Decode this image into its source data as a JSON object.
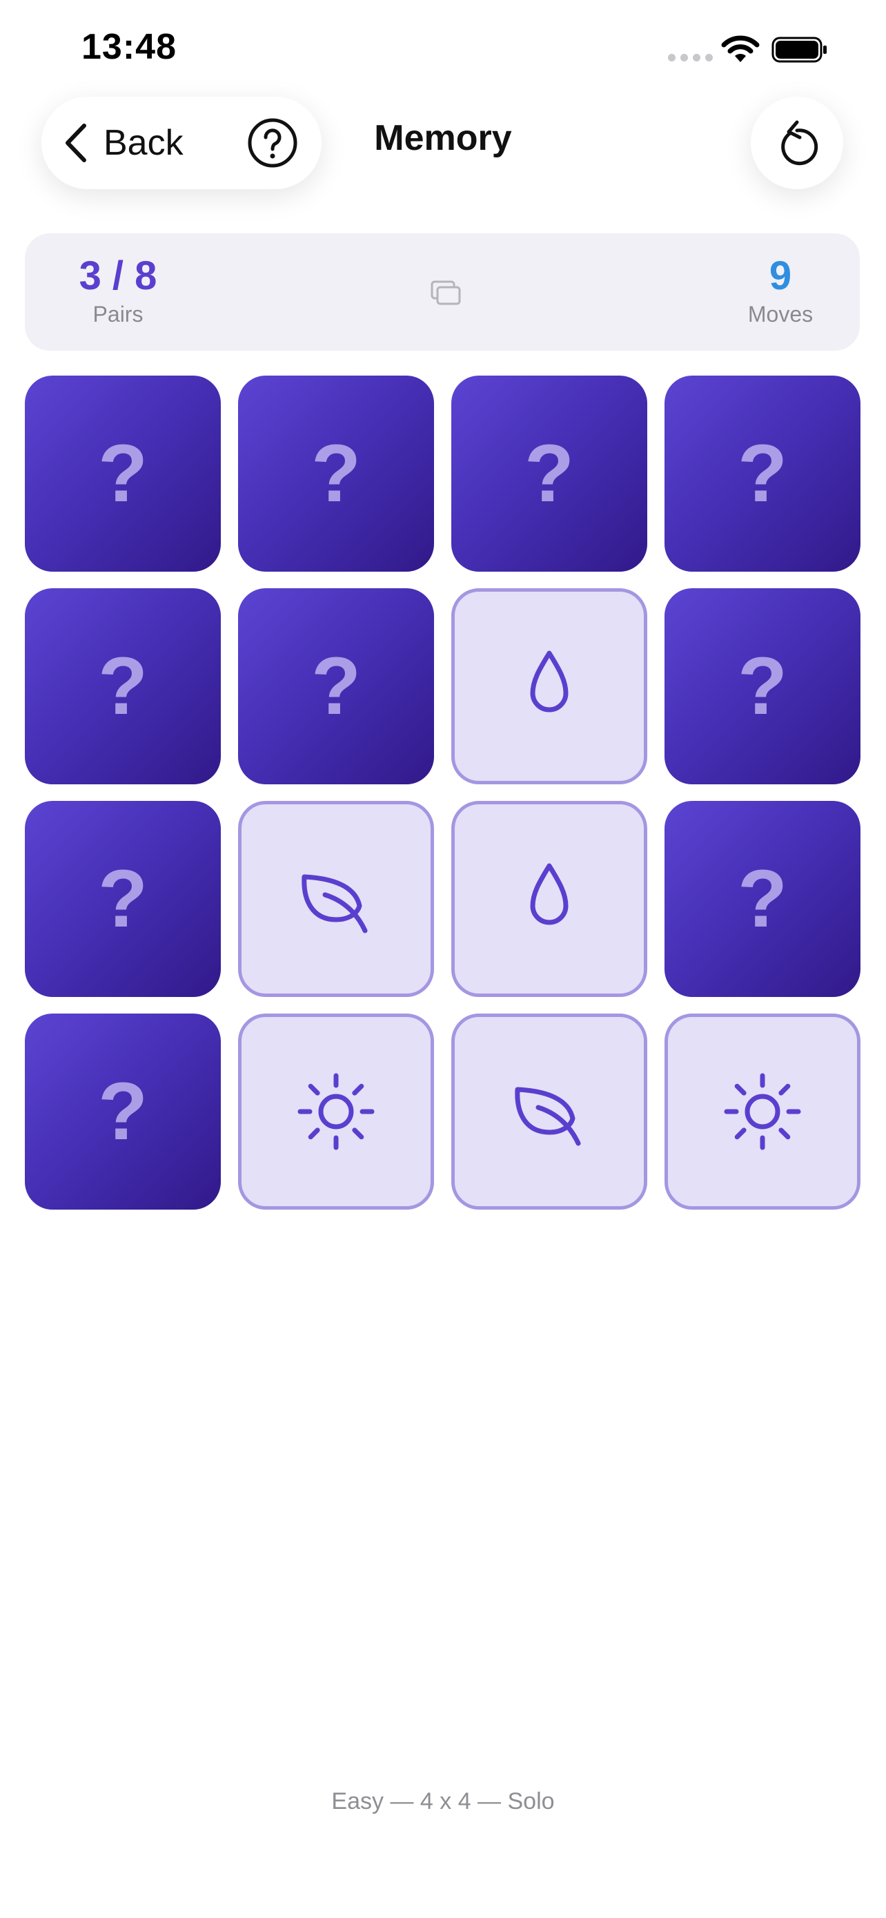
{
  "status_bar": {
    "time": "13:48"
  },
  "nav": {
    "back_label": "Back",
    "title": "Memory"
  },
  "score": {
    "pairs_value": "3 / 8",
    "pairs_label": "Pairs",
    "moves_value": "9",
    "moves_label": "Moves"
  },
  "board": {
    "hidden_glyph": "?",
    "cards": [
      {
        "state": "hidden"
      },
      {
        "state": "hidden"
      },
      {
        "state": "hidden"
      },
      {
        "state": "hidden"
      },
      {
        "state": "hidden"
      },
      {
        "state": "hidden"
      },
      {
        "state": "revealed",
        "icon": "drop-icon"
      },
      {
        "state": "hidden"
      },
      {
        "state": "hidden"
      },
      {
        "state": "revealed",
        "icon": "leaf-icon"
      },
      {
        "state": "revealed",
        "icon": "drop-icon"
      },
      {
        "state": "hidden"
      },
      {
        "state": "hidden"
      },
      {
        "state": "revealed",
        "icon": "sun-icon"
      },
      {
        "state": "revealed",
        "icon": "leaf-icon"
      },
      {
        "state": "revealed",
        "icon": "sun-icon"
      }
    ]
  },
  "footer": {
    "mode": "Easy — 4 x 4 — Solo"
  },
  "colors": {
    "accent_purple": "#5a3fcf",
    "moves_blue": "#2f8ee0",
    "card_back": "#4730b6",
    "card_face": "#e4e0f7",
    "card_border": "#a596e2"
  }
}
